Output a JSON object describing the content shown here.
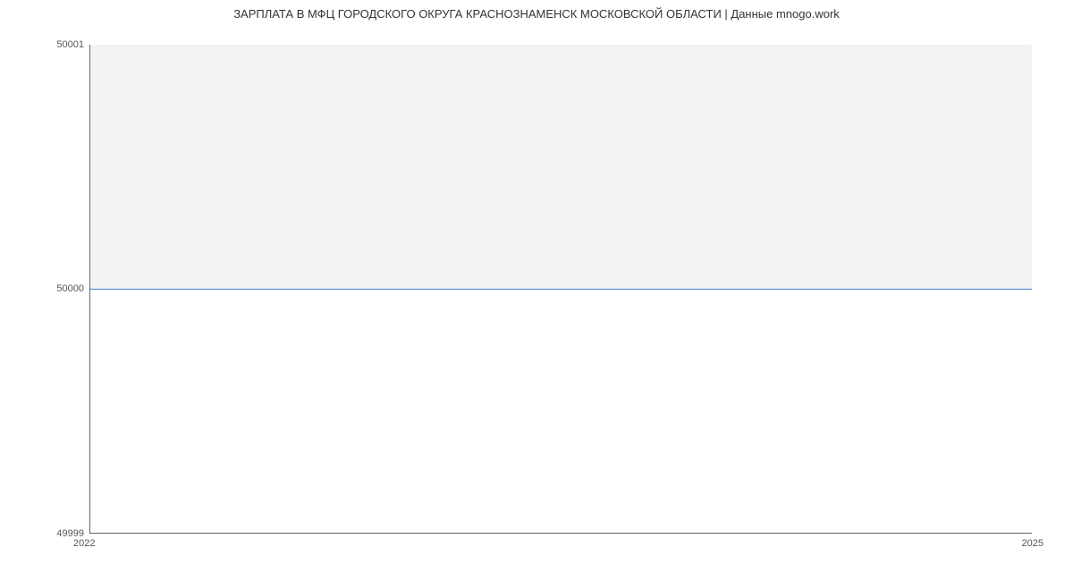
{
  "chart_data": {
    "type": "area",
    "title": "ЗАРПЛАТА В  МФЦ ГОРОДСКОГО ОКРУГА КРАСНОЗНАМЕНСК МОСКОВСКОЙ ОБЛАСТИ | Данные mnogo.work",
    "x": [
      2022,
      2025
    ],
    "values": [
      50000,
      50000
    ],
    "xlabel": "",
    "ylabel": "",
    "xlim": [
      2022,
      2025
    ],
    "ylim": [
      49999,
      50001
    ],
    "x_ticks": [
      "2022",
      "2025"
    ],
    "y_ticks": [
      "49999",
      "50000",
      "50001"
    ],
    "fill_color": "#f3f3f3",
    "line_color": "#4a7fd6"
  }
}
